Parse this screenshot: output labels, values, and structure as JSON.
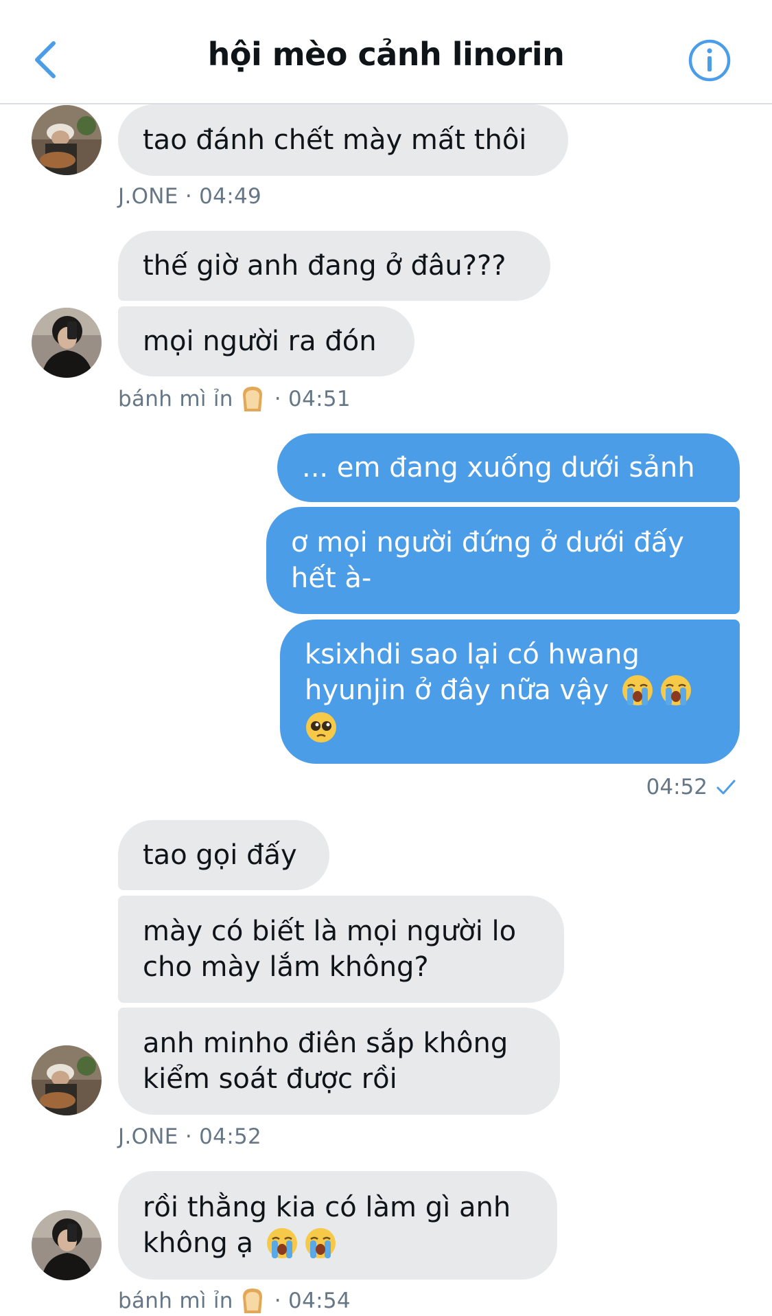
{
  "header": {
    "title": "hội mèo cảnh linorin"
  },
  "messages": [
    {
      "text": "tao đánh chết mày mất thôi"
    },
    {
      "text": "thế giờ anh đang ở đâu???"
    },
    {
      "text": "mọi người ra đón"
    },
    {
      "text": "... em đang xuống dưới sảnh"
    },
    {
      "text": "ơ mọi người đứng ở dưới đấy\nhết à-"
    },
    {
      "text_line1": "ksixhdi sao lại có hwang",
      "text_line2": "hyunjin ở đây nữa vậy"
    },
    {
      "text": "tao gọi đấy"
    },
    {
      "text": "mày có biết là mọi người lo\ncho mày lắm không?"
    },
    {
      "text": "anh minho điên sắp không\nkiểm soát được rồi"
    },
    {
      "text_line1": "rồi thằng kia có làm gì anh",
      "text_line2": "không ạ"
    }
  ],
  "meta": [
    {
      "sender": "J.ONE",
      "time": "· 04:49"
    },
    {
      "sender": "bánh mì ỉn",
      "time": "· 04:51"
    },
    {
      "time": "04:52"
    },
    {
      "sender": "J.ONE",
      "time": "· 04:52"
    },
    {
      "sender": "bánh mì ỉn",
      "time": "· 04:54"
    }
  ],
  "icons": {
    "back": "chevron-left-icon",
    "info": "info-icon",
    "sent": "checkmark-icon",
    "bread": "bread-emoji",
    "crying": "loudly-crying-face-emoji",
    "pleading": "pleading-face-emoji"
  },
  "colors": {
    "accent": "#4c9de8",
    "incoming_bubble": "#e7e9eb",
    "meta_text": "#657786"
  }
}
